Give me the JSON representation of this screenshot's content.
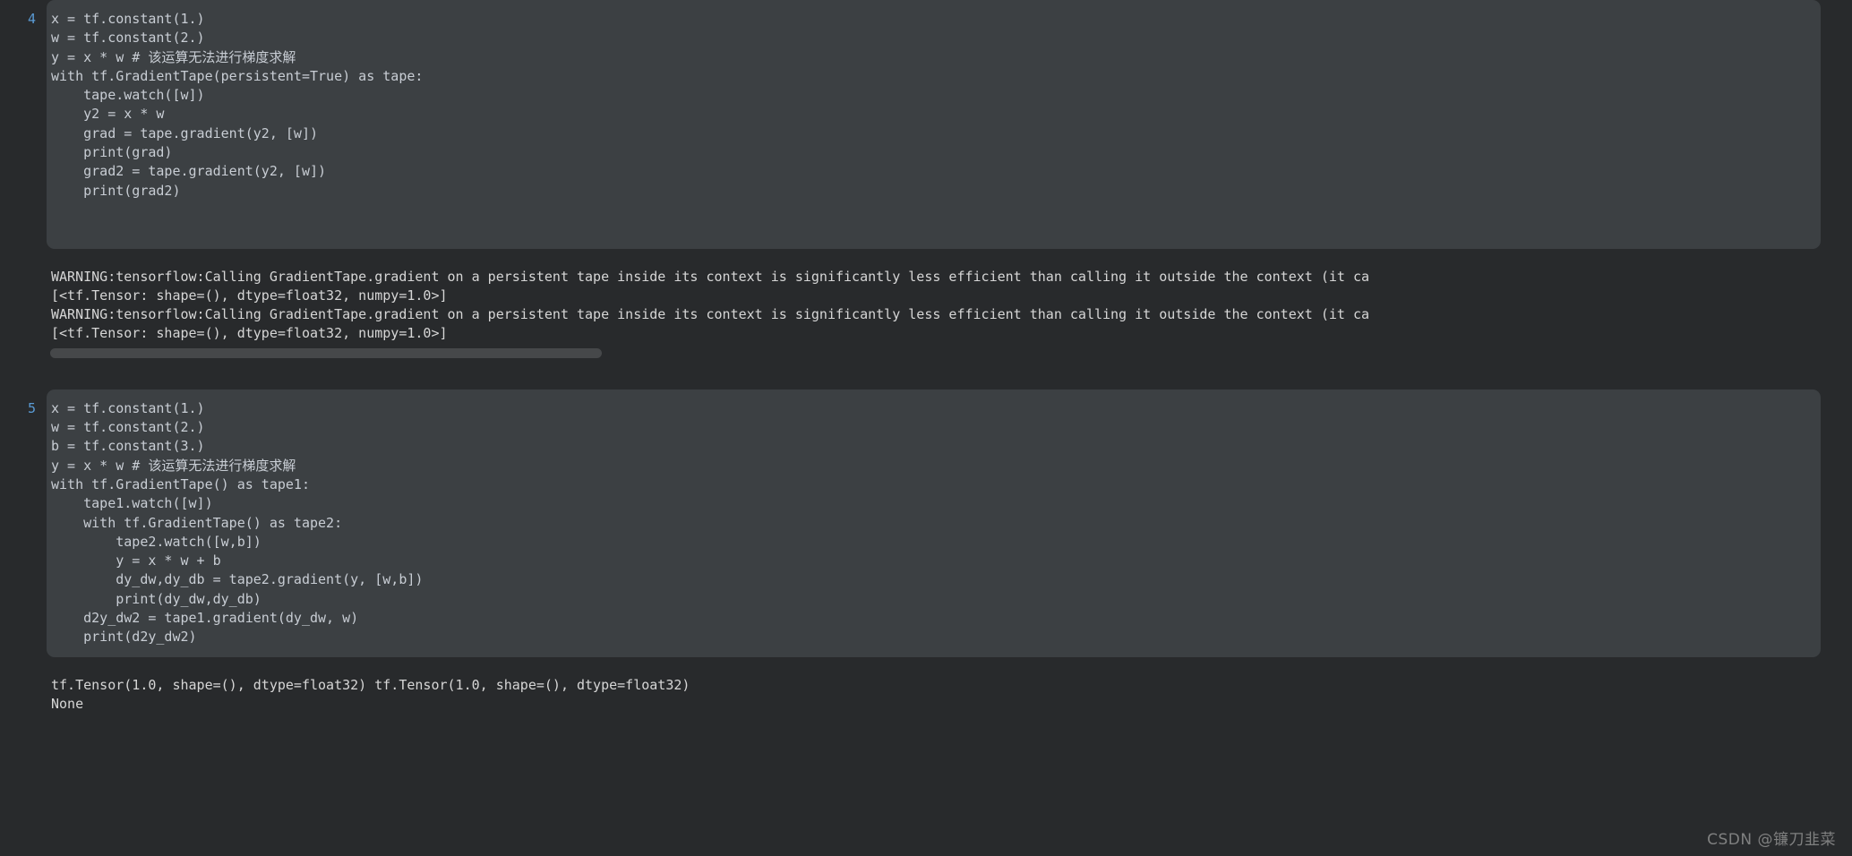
{
  "notebook": {
    "background_color": "#282a2c",
    "code_block_color": "#3c4043",
    "prompt_color": "#5a9bd5",
    "code_text_color": "#c8cdd4",
    "output_text_color": "#d6d6d6"
  },
  "cells": [
    {
      "prompt": "4",
      "code_lines": [
        "x = tf.constant(1.)",
        "w = tf.constant(2.)",
        "y = x * w # 该运算无法进行梯度求解",
        "with tf.GradientTape(persistent=True) as tape:",
        "    tape.watch([w])",
        "    y2 = x * w",
        "    grad = tape.gradient(y2, [w])",
        "    print(grad)",
        "    grad2 = tape.gradient(y2, [w])",
        "    print(grad2)",
        ""
      ],
      "output_lines": [
        "WARNING:tensorflow:Calling GradientTape.gradient on a persistent tape inside its context is significantly less efficient than calling it outside the context (it ca",
        "[<tf.Tensor: shape=(), dtype=float32, numpy=1.0>]",
        "WARNING:tensorflow:Calling GradientTape.gradient on a persistent tape inside its context is significantly less efficient than calling it outside the context (it ca",
        "[<tf.Tensor: shape=(), dtype=float32, numpy=1.0>]"
      ],
      "has_scrollbar": true
    },
    {
      "prompt": "5",
      "code_lines": [
        "x = tf.constant(1.)",
        "w = tf.constant(2.)",
        "b = tf.constant(3.)",
        "y = x * w # 该运算无法进行梯度求解",
        "with tf.GradientTape() as tape1:",
        "    tape1.watch([w])",
        "    with tf.GradientTape() as tape2:",
        "        tape2.watch([w,b])",
        "        y = x * w + b",
        "        dy_dw,dy_db = tape2.gradient(y, [w,b])",
        "        print(dy_dw,dy_db)",
        "    d2y_dw2 = tape1.gradient(dy_dw, w)",
        "    print(d2y_dw2)"
      ],
      "output_lines": [
        "tf.Tensor(1.0, shape=(), dtype=float32) tf.Tensor(1.0, shape=(), dtype=float32)",
        "None"
      ],
      "has_scrollbar": false
    }
  ],
  "watermark": {
    "text": "CSDN @镰刀韭菜"
  }
}
